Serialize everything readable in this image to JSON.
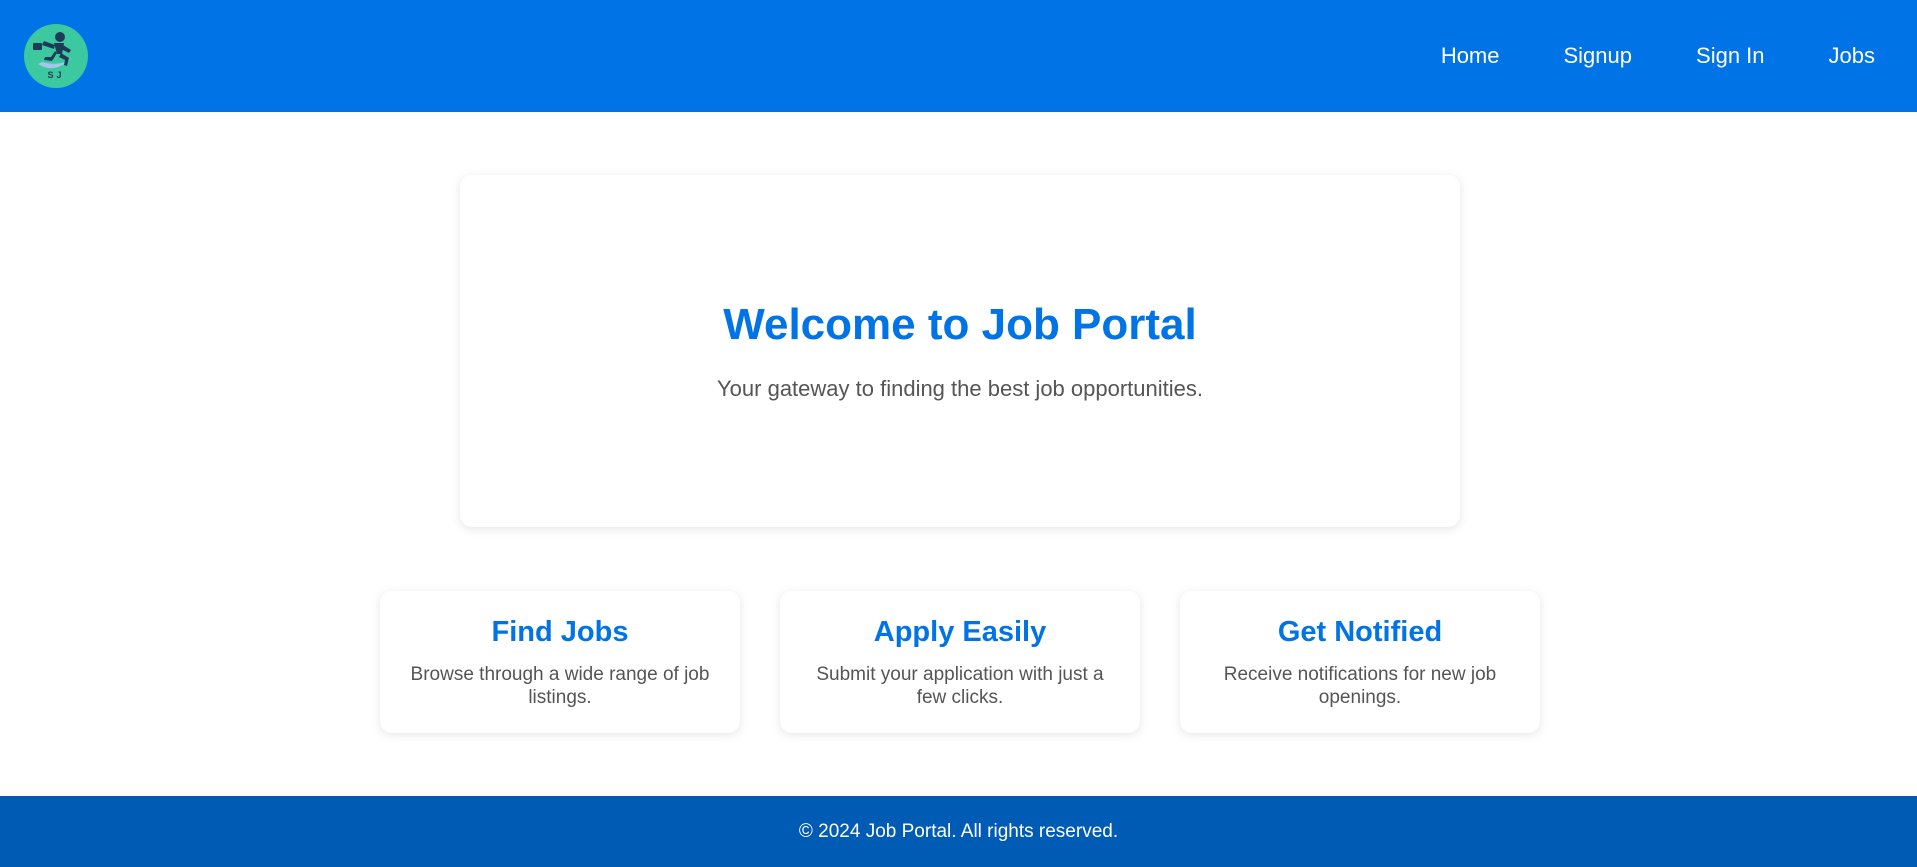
{
  "brand": {
    "logo_text": "SJ",
    "logo_icon": "running-person-icon",
    "colors": {
      "primary": "#0073e6",
      "footer": "#005bb5",
      "logo_bg": "#3cc9a0"
    }
  },
  "nav": {
    "items": [
      {
        "label": "Home"
      },
      {
        "label": "Signup"
      },
      {
        "label": "Sign In"
      },
      {
        "label": "Jobs"
      }
    ]
  },
  "hero": {
    "title": "Welcome to Job Portal",
    "subtitle": "Your gateway to finding the best job opportunities."
  },
  "features": [
    {
      "title": "Find Jobs",
      "description": "Browse through a wide range of job listings."
    },
    {
      "title": "Apply Easily",
      "description": "Submit your application with just a few clicks."
    },
    {
      "title": "Get Notified",
      "description": "Receive notifications for new job openings."
    }
  ],
  "footer": {
    "text": "© 2024 Job Portal. All rights reserved."
  }
}
